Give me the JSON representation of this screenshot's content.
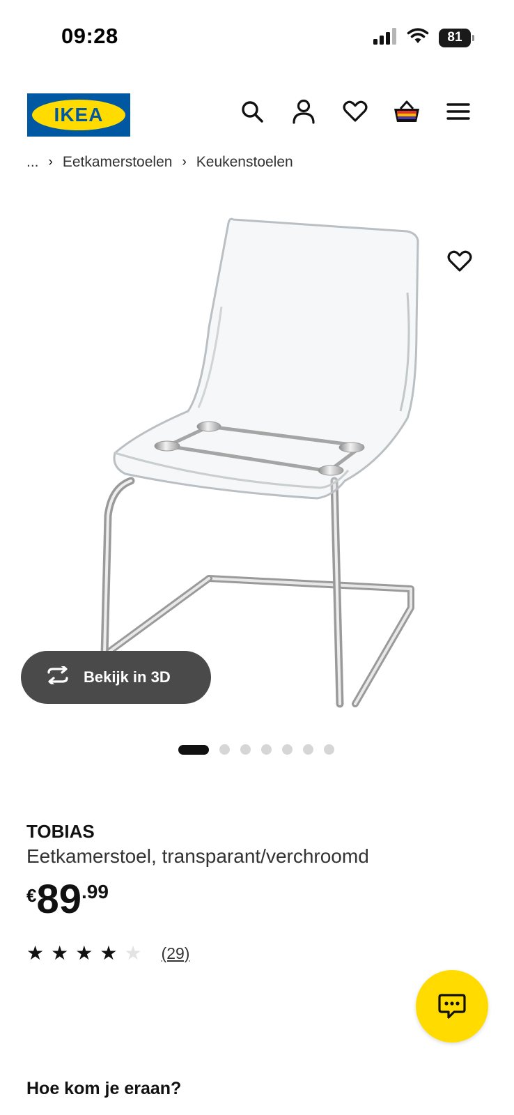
{
  "status_bar": {
    "time": "09:28",
    "battery": "81",
    "icons": [
      "signal-icon",
      "wifi-icon",
      "battery-icon"
    ]
  },
  "header": {
    "logo_text": "IKEA",
    "icons": [
      "search-icon",
      "account-icon",
      "heart-icon",
      "basket-icon",
      "menu-icon"
    ]
  },
  "breadcrumb": {
    "ellipsis": "...",
    "items": [
      "Eetkamerstoelen",
      "Keukenstoelen"
    ]
  },
  "gallery": {
    "view_3d_label": "Bekijk in 3D",
    "dots_total": 7,
    "active_dot": 0
  },
  "product": {
    "name": "TOBIAS",
    "description": "Eetkamerstoel, transparant/verchroomd",
    "price_currency": "€",
    "price_integer": "89",
    "price_decimal": ".99",
    "rating": 4,
    "rating_max": 5,
    "review_count": "(29)"
  },
  "section": {
    "heading": "Hoe kom je eraan?"
  },
  "colors": {
    "ikea_blue": "#0058a3",
    "ikea_yellow": "#ffdb00",
    "view3d_bg": "#4a4a4a"
  }
}
